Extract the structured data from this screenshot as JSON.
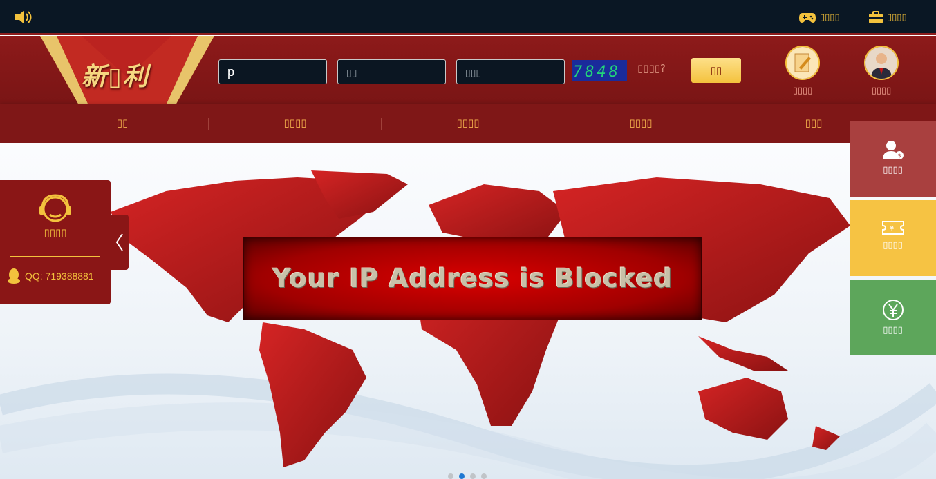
{
  "topbar": {
    "sound_icon": "speaker-icon",
    "links": [
      {
        "icon": "gamepad-icon",
        "label": "▯▯▯▯"
      },
      {
        "icon": "briefcase-icon",
        "label": "▯▯▯▯"
      }
    ]
  },
  "header": {
    "logo_text": "新▯利",
    "username_value": "p",
    "password_placeholder": "▯▯",
    "captcha_placeholder": "▯▯▯",
    "captcha_code": "7848",
    "forgot_label": "▯▯▯▯?",
    "login_label": "▯▯",
    "actions": [
      {
        "icon": "register-icon",
        "label": "▯▯▯▯"
      },
      {
        "icon": "customer-service-icon",
        "label": "▯▯▯▯"
      }
    ]
  },
  "nav": {
    "items": [
      "▯▯",
      "▯▯▯▯",
      "▯▯▯▯",
      "▯▯▯▯",
      "▯▯▯"
    ]
  },
  "banner": {
    "message": "Your IP Address is Blocked",
    "slide_count": 4,
    "active_slide": 2
  },
  "service_widget": {
    "label": "▯▯▯▯",
    "qq": "QQ: 719388881"
  },
  "right_panels": [
    {
      "icon": "user-coin-icon",
      "label": "▯▯▯▯",
      "color": "#a9403f"
    },
    {
      "icon": "ticket-icon",
      "label": "▯▯▯▯",
      "color": "#f6c343"
    },
    {
      "icon": "yuan-icon",
      "label": "▯▯▯▯",
      "color": "#5da65b"
    }
  ],
  "colors": {
    "topbar": "#0a1724",
    "header": "#8d1a1a",
    "nav": "#7f1717",
    "gold": "#f3c23d"
  }
}
